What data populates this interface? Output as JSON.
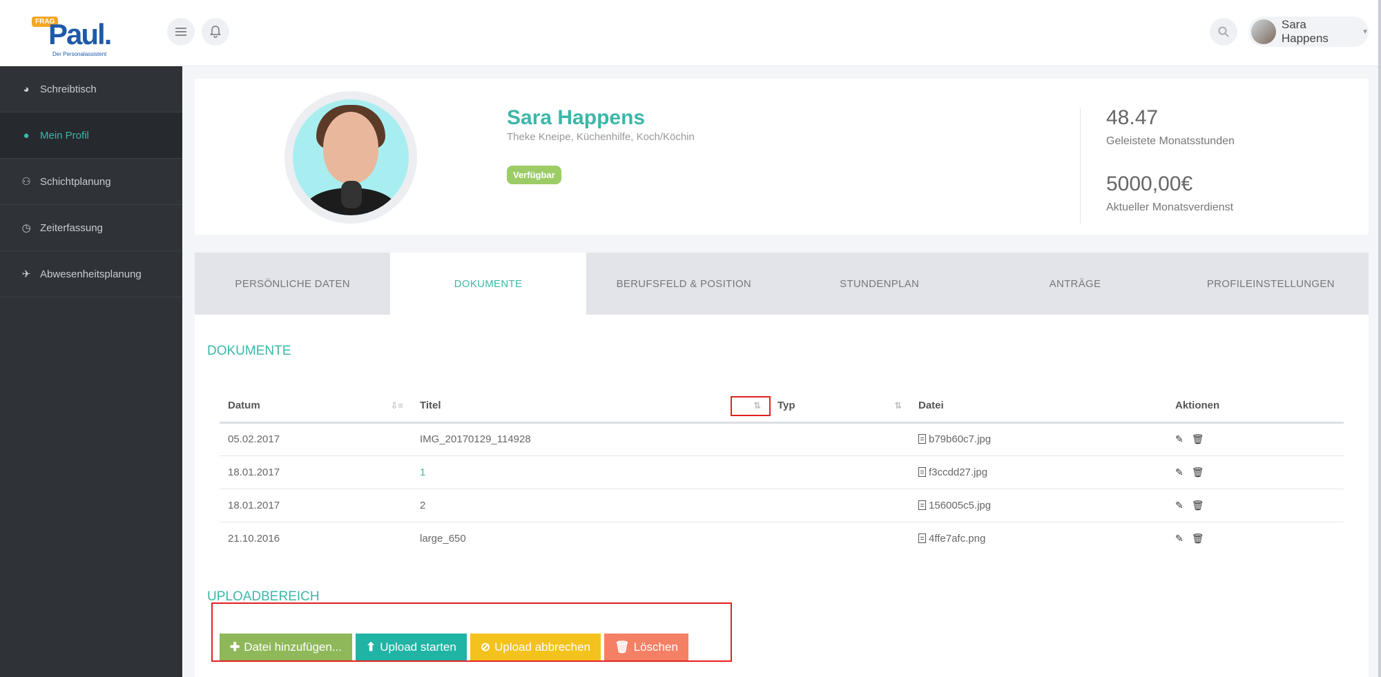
{
  "header": {
    "logo_frag": "FRAG",
    "logo_name": "Paul.",
    "logo_sub": "Der Personalassistent",
    "user_name": "Sara Happens"
  },
  "sidebar": {
    "items": [
      {
        "label": "Schreibtisch",
        "icon": "dashboard-icon"
      },
      {
        "label": "Mein Profil",
        "icon": "user-icon"
      },
      {
        "label": "Schichtplanung",
        "icon": "users-icon"
      },
      {
        "label": "Zeiterfassung",
        "icon": "clock-icon"
      },
      {
        "label": "Abwesenheitsplanung",
        "icon": "plane-icon"
      }
    ]
  },
  "profile": {
    "name": "Sara Happens",
    "roles": "Theke Kneipe, Küchenhilfe, Koch/Köchin",
    "status": "Verfügbar",
    "hours_value": "48.47",
    "hours_label": "Geleistete Monatsstunden",
    "earnings_value": "5000,00€",
    "earnings_label": "Aktueller Monatsverdienst"
  },
  "tabs": [
    "PERSÖNLICHE DATEN",
    "DOKUMENTE",
    "BERUFSFELD & POSITION",
    "STUNDENPLAN",
    "ANTRÄGE",
    "PROFILEINSTELLUNGEN"
  ],
  "documents": {
    "title": "DOKUMENTE",
    "columns": [
      "Datum",
      "Titel",
      "Typ",
      "Datei",
      "Aktionen"
    ],
    "rows": [
      {
        "datum": "05.02.2017",
        "titel": "IMG_20170129_114928",
        "typ": "",
        "datei": "b79b60c7.jpg"
      },
      {
        "datum": "18.01.2017",
        "titel": "1",
        "typ": "",
        "datei": "f3ccdd27.jpg"
      },
      {
        "datum": "18.01.2017",
        "titel": "2",
        "typ": "",
        "datei": "156005c5.jpg"
      },
      {
        "datum": "21.10.2016",
        "titel": "large_650",
        "typ": "",
        "datei": "4ffe7afc.png"
      }
    ]
  },
  "upload": {
    "title": "UPLOADBEREICH",
    "add_label": "Datei hinzufügen...",
    "start_label": "Upload starten",
    "cancel_label": "Upload abbrechen",
    "delete_label": "Löschen"
  },
  "colors": {
    "accent": "#3bb7a9",
    "sidebar_bg": "#2f3338",
    "badge_green": "#9ccc65",
    "btn_green": "#8fb85a",
    "btn_teal": "#1fb4a4",
    "btn_yellow": "#f4c21c",
    "btn_red": "#f58065",
    "highlight": "#e32020"
  }
}
